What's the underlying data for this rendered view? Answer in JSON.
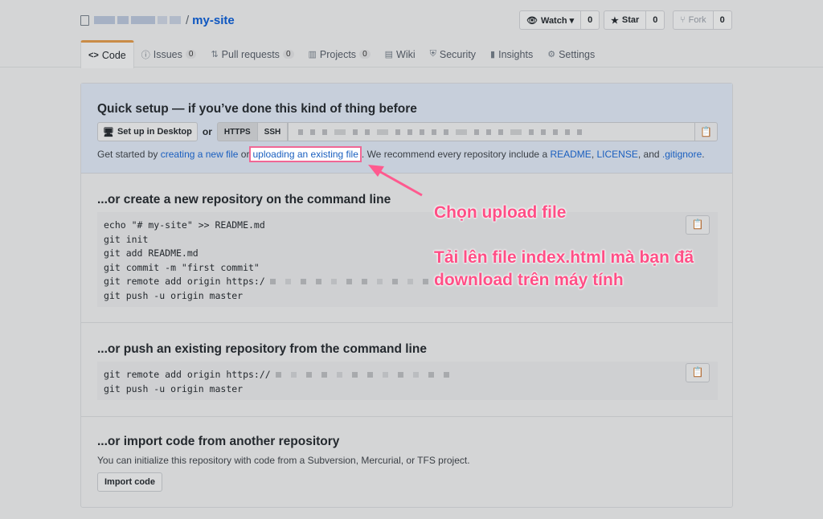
{
  "repo": {
    "name": "my-site",
    "slash": "/"
  },
  "header_actions": [
    {
      "label": "Watch ▾",
      "count": "0",
      "icon": "eye-icon"
    },
    {
      "label": "Star",
      "count": "0",
      "icon": "star-icon"
    },
    {
      "label": "Fork",
      "count": "0",
      "icon": "fork-icon"
    }
  ],
  "tabs": [
    {
      "label": "Code",
      "icon": "code-icon"
    },
    {
      "label": "Issues",
      "count": "0",
      "icon": "issue-icon"
    },
    {
      "label": "Pull requests",
      "count": "0",
      "icon": "pull-request-icon"
    },
    {
      "label": "Projects",
      "count": "0",
      "icon": "project-icon"
    },
    {
      "label": "Wiki",
      "icon": "book-icon"
    },
    {
      "label": "Security",
      "icon": "shield-icon"
    },
    {
      "label": "Insights",
      "icon": "graph-icon"
    },
    {
      "label": "Settings",
      "icon": "gear-icon"
    }
  ],
  "quick_setup": {
    "title": "Quick setup — if you’ve done this kind of thing before",
    "desktop_button": "Set up in Desktop",
    "or": "or",
    "https": "HTTPS",
    "ssh": "SSH",
    "get_started_prefix": "Get started by",
    "creating_link": "creating a new file",
    "or_word": "or",
    "uploading_link": "uploading an existing file",
    "recommend_text": ". We recommend every repository include a",
    "readme_link": "README",
    "comma": ",",
    "license_link": "LICENSE",
    "and_text": ", and",
    "gitignore_link": ".gitignore",
    "period": "."
  },
  "new_repo": {
    "title": "...or create a new repository on the command line",
    "lines": [
      "echo \"# my-site\" >> README.md",
      "git init",
      "git add README.md",
      "git commit -m \"first commit\"",
      "git remote add origin https:/",
      "git push -u origin master"
    ]
  },
  "push_existing": {
    "title": "...or push an existing repository from the command line",
    "lines": [
      "git remote add origin https://",
      "git push -u origin master"
    ]
  },
  "import": {
    "title": "...or import code from another repository",
    "description": "You can initialize this repository with code from a Subversion, Mercurial, or TFS project.",
    "button": "Import code"
  },
  "annotation": {
    "line1": "Chọn upload file",
    "line2": "Tải lên file index.html mà bạn đã",
    "line3": "download trên máy tính",
    "color": "#ff4f86"
  }
}
